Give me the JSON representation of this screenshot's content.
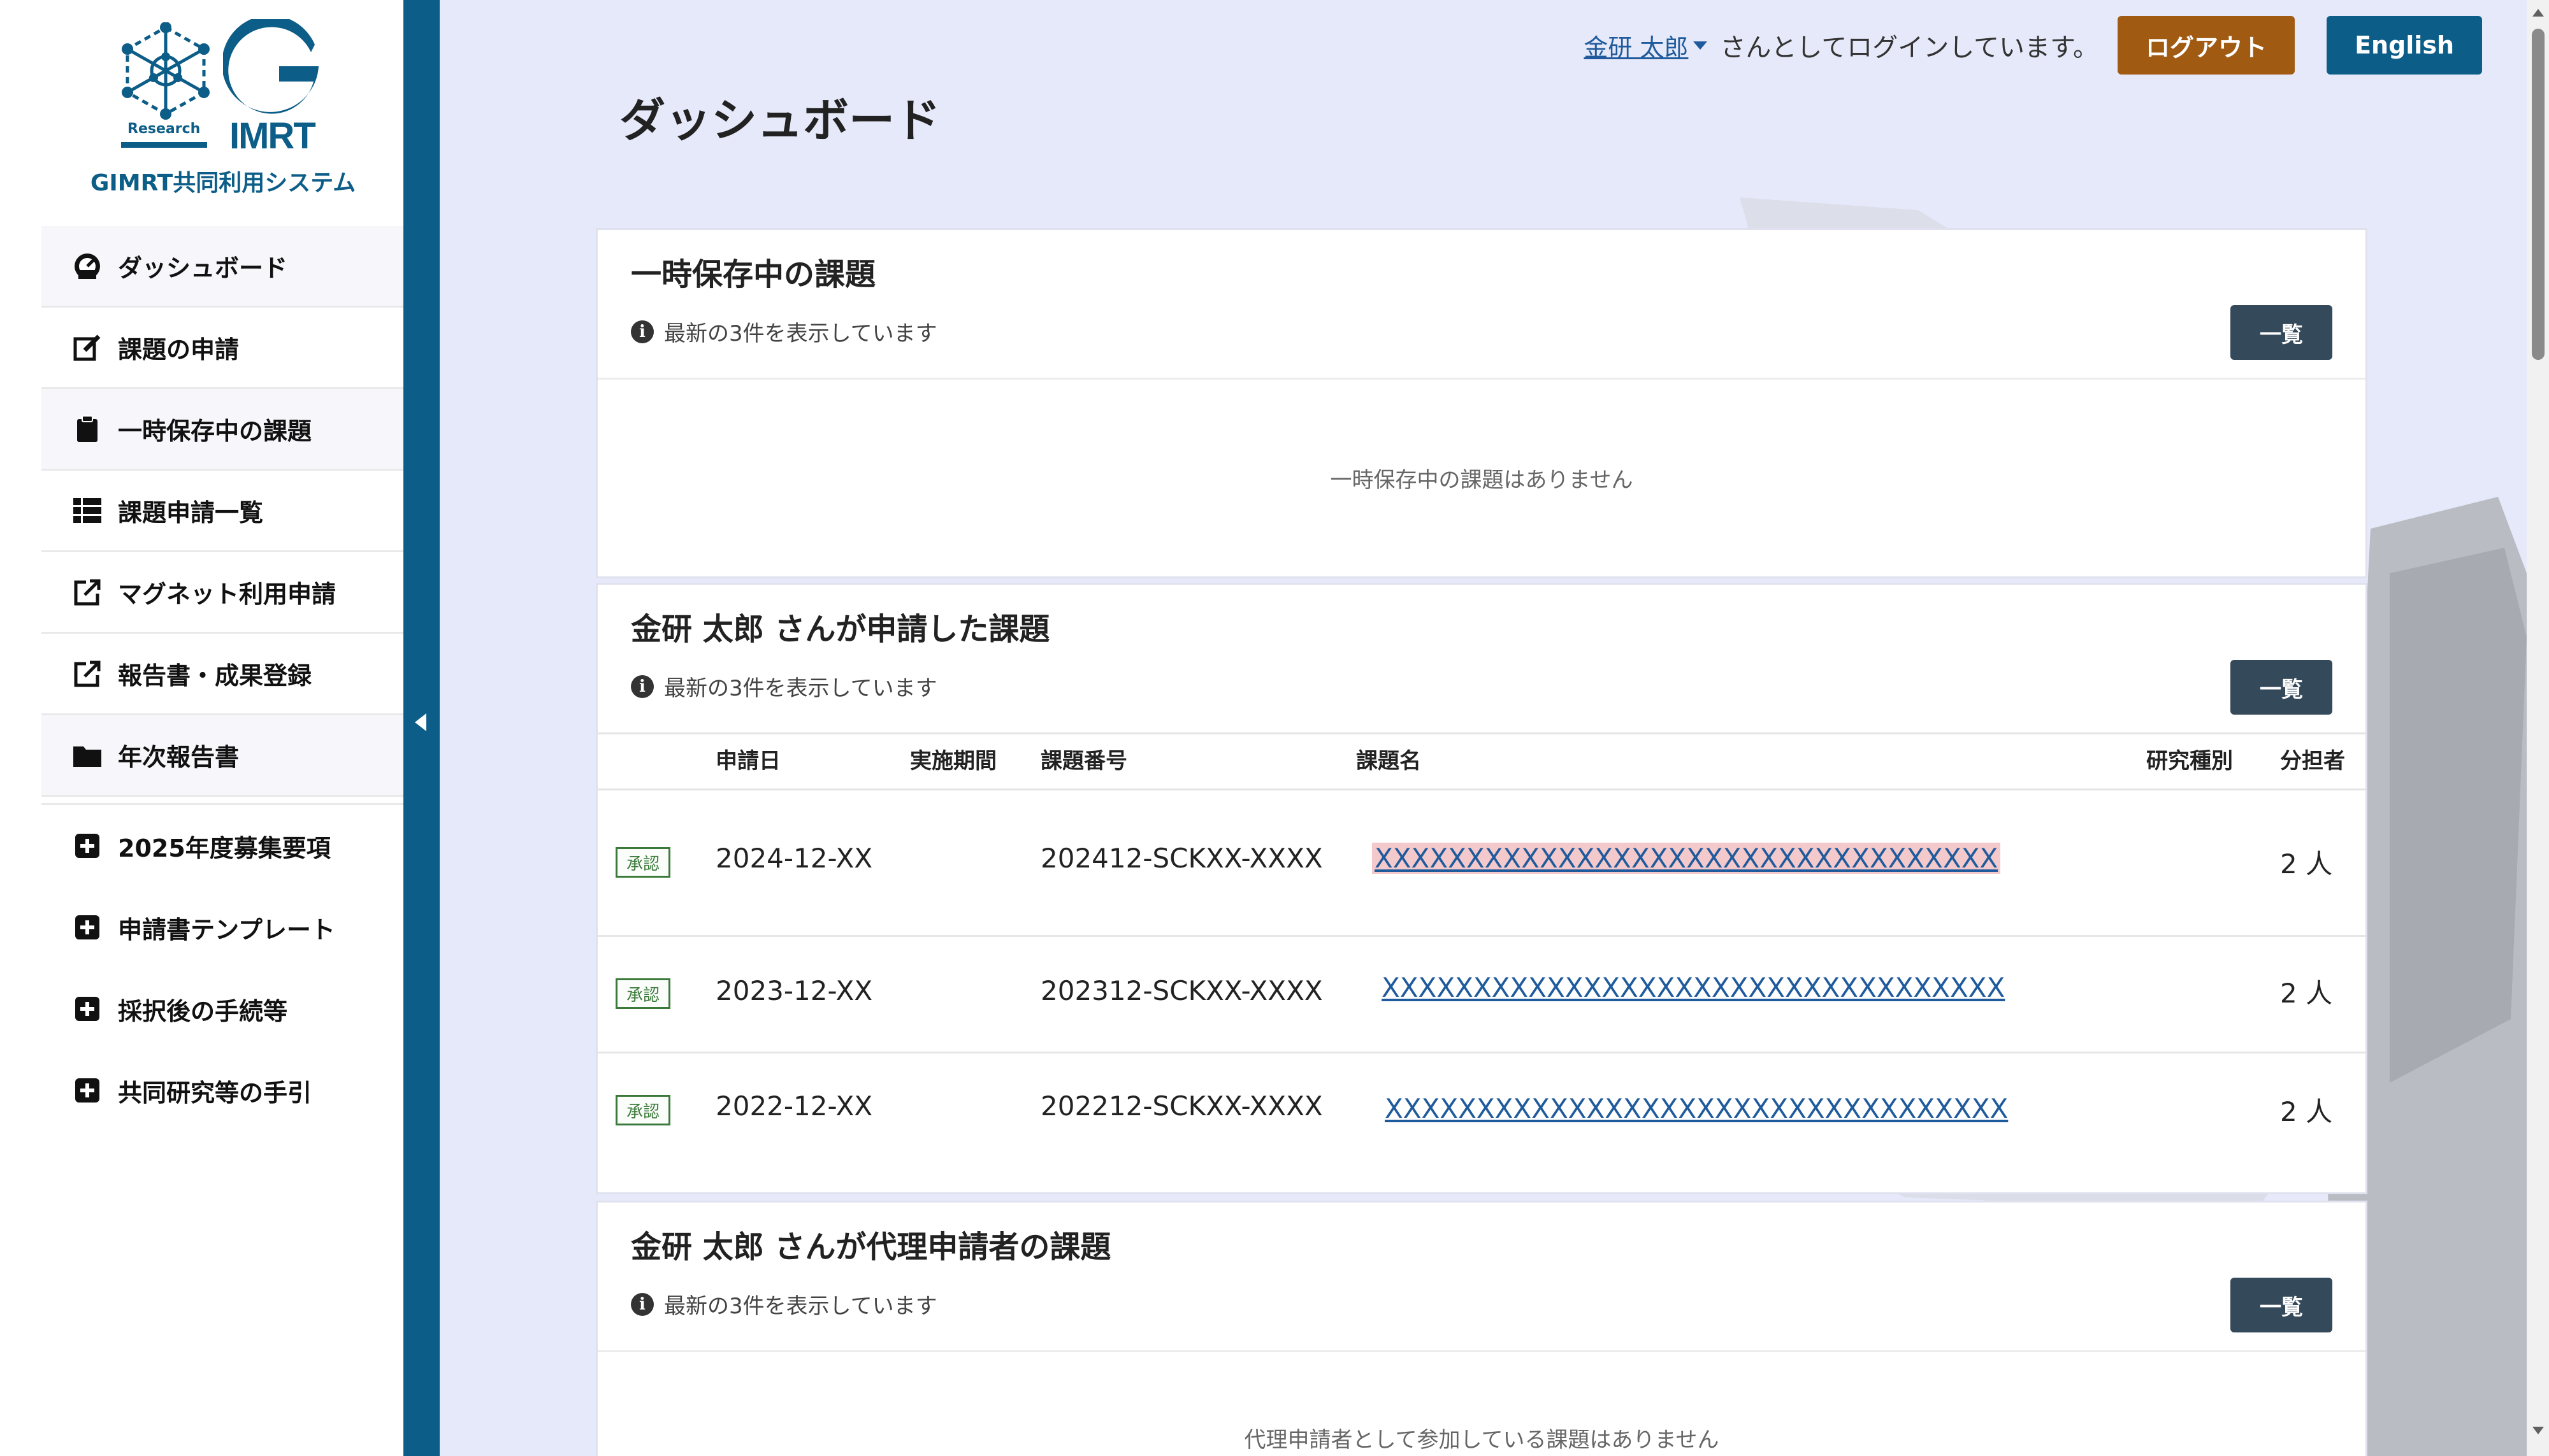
{
  "logo": {
    "research": "Research",
    "imrt": "IMRT",
    "caption": "GIMRT共同利用システム"
  },
  "sidebar": {
    "items": [
      {
        "label": "ダッシュボード",
        "icon": "dashboard-icon"
      },
      {
        "label": "課題の申請",
        "icon": "edit-icon"
      },
      {
        "label": "一時保存中の課題",
        "icon": "clipboard-icon"
      },
      {
        "label": "課題申請一覧",
        "icon": "list-icon"
      },
      {
        "label": "マグネット利用申請",
        "icon": "external-link-icon"
      },
      {
        "label": "報告書・成果登録",
        "icon": "external-link-icon"
      },
      {
        "label": "年次報告書",
        "icon": "folder-icon"
      }
    ],
    "links": [
      {
        "label": "2025年度募集要項",
        "icon": "plus-square-icon"
      },
      {
        "label": "申請書テンプレート",
        "icon": "plus-square-icon"
      },
      {
        "label": "採択後の手続等",
        "icon": "plus-square-icon"
      },
      {
        "label": "共同研究等の手引",
        "icon": "plus-square-icon"
      }
    ]
  },
  "header": {
    "user_name": "金研 太郎",
    "login_text": "さんとしてログインしています。",
    "logout_label": "ログアウト",
    "english_label": "English"
  },
  "page_title": "ダッシュボード",
  "cards": {
    "drafts": {
      "title": "一時保存中の課題",
      "note": "最新の3件を表示しています",
      "button": "一覧",
      "empty": "一時保存中の課題はありません"
    },
    "applied": {
      "title": "金研 太郎 さんが申請した課題",
      "note": "最新の3件を表示しています",
      "button": "一覧",
      "columns": [
        "申請日",
        "実施期間",
        "課題番号",
        "課題名",
        "研究種別",
        "分担者"
      ],
      "rows": [
        {
          "status": "承認",
          "date": "2024-12-XX",
          "period": "",
          "number": "202412-SCKXX-XXXX",
          "name": "XXXXXXXXXXXXXXXXXXXXXXXXXXXXXXXXXX",
          "type": "",
          "members": "2 人"
        },
        {
          "status": "承認",
          "date": "2023-12-XX",
          "period": "",
          "number": "202312-SCKXX-XXXX",
          "name": "XXXXXXXXXXXXXXXXXXXXXXXXXXXXXXXXXX",
          "type": "",
          "members": "2 人"
        },
        {
          "status": "承認",
          "date": "2022-12-XX",
          "period": "",
          "number": "202212-SCKXX-XXXX",
          "name": "XXXXXXXXXXXXXXXXXXXXXXXXXXXXXXXXXX",
          "type": "",
          "members": "2 人"
        }
      ]
    },
    "proxy": {
      "title": "金研 太郎 さんが代理申請者の課題",
      "note": "最新の3件を表示しています",
      "button": "一覧",
      "empty": "代理申請者として参加している課題はありません"
    }
  },
  "colors": {
    "brand": "#0c5d87",
    "logout": "#a15a12",
    "list_button": "#34495a",
    "approved": "#3a7a3a",
    "link": "#1f5b9c",
    "highlight": "#f4c9cb"
  }
}
